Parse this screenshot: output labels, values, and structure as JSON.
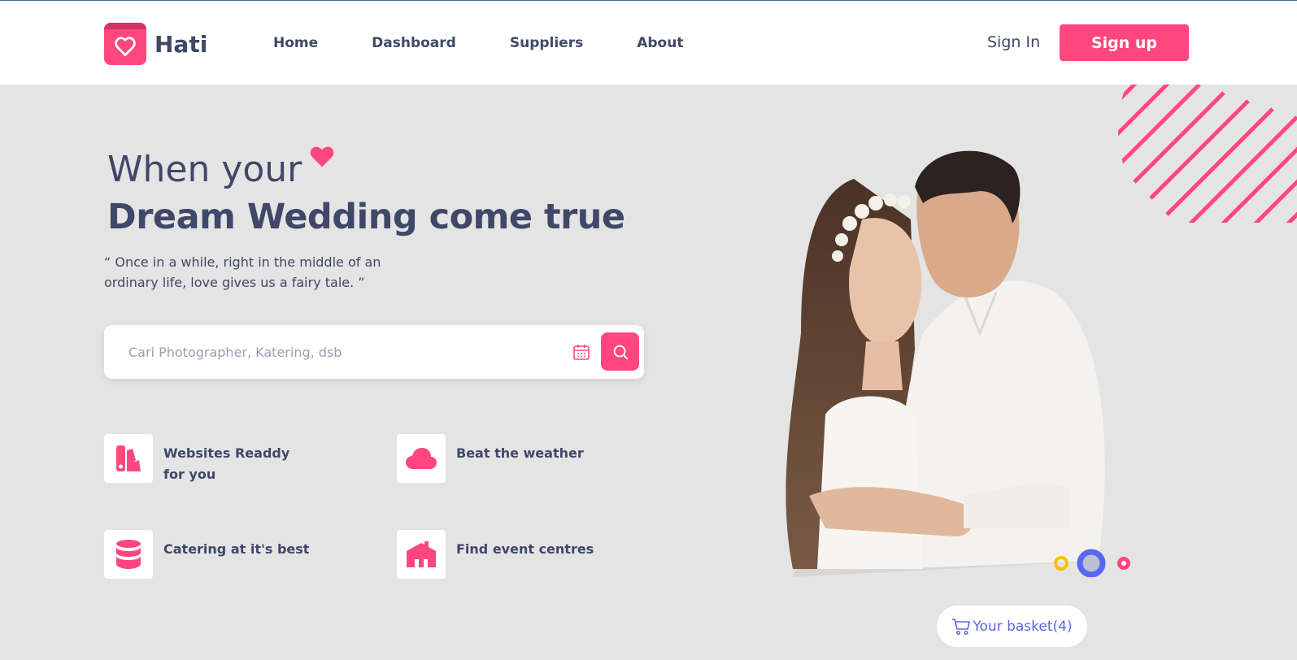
{
  "brand": {
    "name": "Hati",
    "logo_icon": "heart-icon"
  },
  "nav": [
    {
      "label": "Home"
    },
    {
      "label": "Dashboard"
    },
    {
      "label": "Suppliers"
    },
    {
      "label": "About"
    }
  ],
  "auth": {
    "signin_label": "Sign In",
    "signup_label": "Sign up"
  },
  "hero": {
    "line1": "When your",
    "line2": "Dream Wedding come true",
    "quote": "“ Once in a while, right in the middle of an ordinary life, love gives us a fairy tale. ”"
  },
  "search": {
    "placeholder": "Cari Photographer, Katering, dsb",
    "value": ""
  },
  "features": [
    {
      "label": "Websites Readdy for you",
      "icon": "palette-icon"
    },
    {
      "label": "Beat the weather",
      "icon": "cloud-icon"
    },
    {
      "label": "Catering at it's best",
      "icon": "database-icon"
    },
    {
      "label": "Find event centres",
      "icon": "venue-icon"
    }
  ],
  "basket": {
    "label": "Your basket(4)"
  },
  "colors": {
    "accent": "#ff477e",
    "text": "#3f4868",
    "background": "#e5e4e4",
    "basket": "#5b66e0"
  }
}
